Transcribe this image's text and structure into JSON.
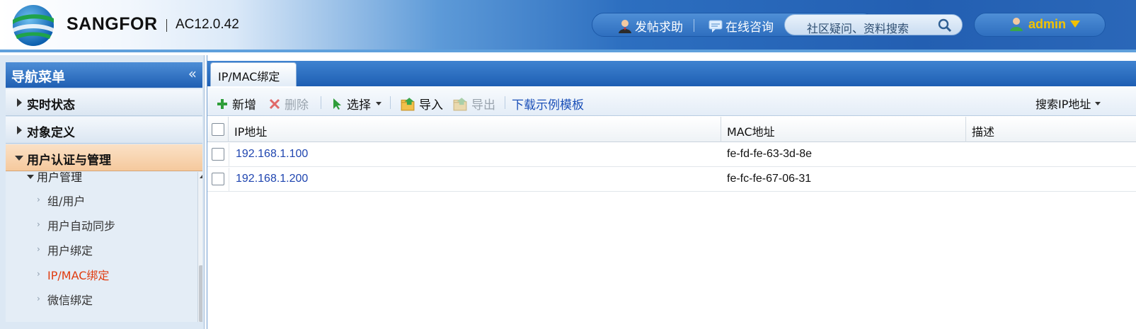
{
  "header": {
    "brand": "SANGFOR",
    "version": "AC12.0.42",
    "post_help": "发帖求助",
    "online_consult": "在线咨询",
    "search_placeholder": "社区疑问、资料搜索",
    "user": "admin"
  },
  "sidebar": {
    "title": "导航菜单",
    "collapse_glyph": "«",
    "sections": [
      {
        "label": "实时状态"
      },
      {
        "label": "对象定义"
      },
      {
        "label": "用户认证与管理"
      }
    ],
    "sub_header": "用户管理",
    "sub_items": [
      {
        "label": "组/用户"
      },
      {
        "label": "用户自动同步"
      },
      {
        "label": "用户绑定"
      },
      {
        "label": "IP/MAC绑定"
      },
      {
        "label": "微信绑定"
      }
    ]
  },
  "main": {
    "tab": "IP/MAC绑定",
    "toolbar": {
      "add": "新增",
      "delete": "删除",
      "select": "选择",
      "import": "导入",
      "export": "导出",
      "download_template": "下载示例模板",
      "search_ip": "搜索IP地址"
    },
    "columns": [
      "IP地址",
      "MAC地址",
      "描述"
    ],
    "rows": [
      {
        "ip": "192.168.1.100",
        "mac": "fe-fd-fe-63-3d-8e",
        "desc": ""
      },
      {
        "ip": "192.168.1.200",
        "mac": "fe-fc-fe-67-06-31",
        "desc": ""
      }
    ]
  },
  "colors": {
    "accent_blue": "#1e5eb3",
    "active_item": "#e03c10",
    "username": "#f2c200",
    "link": "#1f45b0"
  }
}
